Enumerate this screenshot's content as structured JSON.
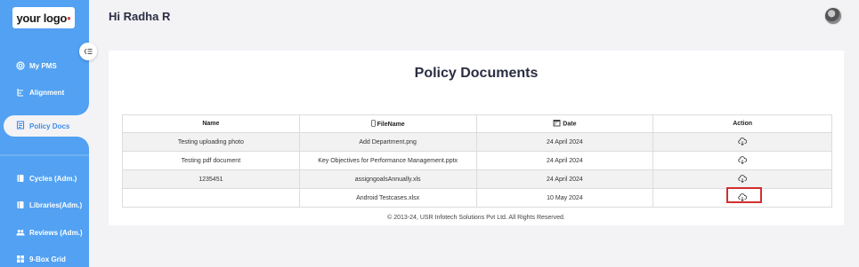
{
  "brand": {
    "logo_text": "your logo"
  },
  "header": {
    "greeting": "Hi Radha R"
  },
  "sidebar": {
    "items": [
      {
        "label": "My PMS",
        "icon": "target-icon"
      },
      {
        "label": "Alignment",
        "icon": "alignment-icon"
      },
      {
        "label": "Policy Docs",
        "icon": "document-icon",
        "active": true
      },
      {
        "label": "Cycles (Adm.)",
        "icon": "book-icon"
      },
      {
        "label": "Libraries(Adm.)",
        "icon": "book-icon"
      },
      {
        "label": "Reviews (Adm.)",
        "icon": "users-icon"
      },
      {
        "label": "9-Box Grid",
        "icon": "grid-icon"
      }
    ]
  },
  "main": {
    "title": "Policy Documents",
    "table": {
      "headers": [
        "Name",
        "FileName",
        "Date",
        "Action"
      ],
      "rows": [
        {
          "name": "Testing uploading photo",
          "file": "Add Department.png",
          "date": "24 April 2024"
        },
        {
          "name": "Testing pdf document",
          "file": "Key Objectives for Performance Management.pptx",
          "date": "24 April 2024"
        },
        {
          "name": "1235451",
          "file": "assigngoalsAnnually.xls",
          "date": "24 April 2024"
        },
        {
          "name": "",
          "file": "Android Testcases.xlsx",
          "date": "10 May 2024"
        }
      ]
    },
    "footer": "© 2013-24, USR Infotech Solutions Pvt Ltd. All Rights Reserved."
  },
  "colors": {
    "sidebar": "#52a1f2",
    "highlight": "#d32f2f",
    "title": "#2b2d42"
  }
}
